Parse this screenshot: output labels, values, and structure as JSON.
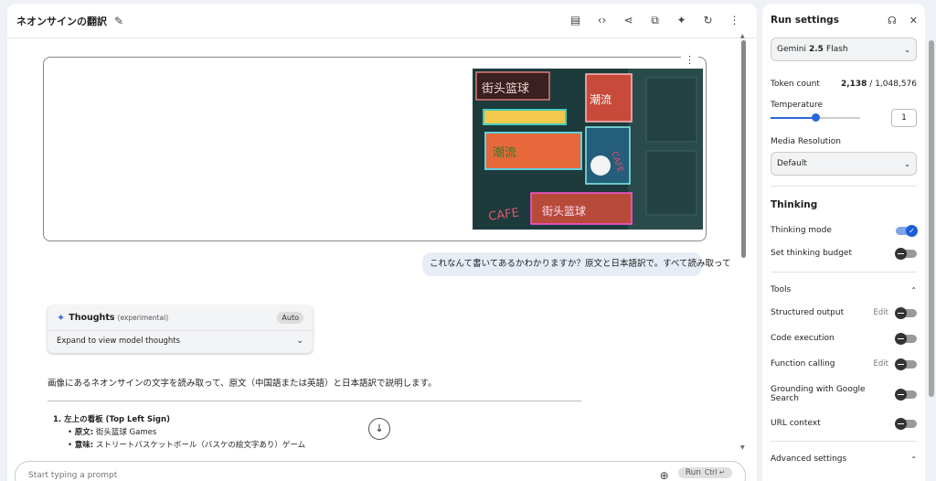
{
  "header": {
    "title": "ネオンサインの翻訳",
    "actions": [
      "clipboard-icon",
      "code-icon",
      "share-icon",
      "copy-icon",
      "sparkle-icon",
      "refresh-icon",
      "more-vert-icon"
    ]
  },
  "chat": {
    "image_alt": "neon-signs-photo",
    "image_signs": {
      "top_left": "街头篮球",
      "top_right": "潮流",
      "center": "潮流",
      "bottom_left": "CAFE",
      "bottom_right": "街头篮球",
      "right_vertical": "CAFE"
    },
    "user_message": "これなんて書いてあるかわかりますか？原文と日本語訳で。すべて読み取って",
    "thoughts": {
      "title": "Thoughts",
      "subtitle": "(experimental)",
      "badge": "Auto",
      "expand_label": "Expand to view model thoughts"
    },
    "answer_intro": "画像にあるネオンサインの文字を読み取って、原文（中国語または英語）と日本語訳で説明します。",
    "list_item_1": {
      "heading": "1. 左上の看板 (Top Left Sign)",
      "original_label": "原文:",
      "original_value": " 街头篮球 Games",
      "meaning_label": "意味:",
      "meaning_value": " ストリートバスケットボール（バスケの絵文字あり）ゲーム"
    }
  },
  "prompt": {
    "placeholder": "Start typing a prompt",
    "run_label": "Run",
    "run_shortcut": "Ctrl ↵"
  },
  "settings": {
    "title": "Run settings",
    "model_prefix": "Gemini",
    "model_version": "2.5",
    "model_suffix": "Flash",
    "token_count_label": "Token count",
    "token_used": "2,138",
    "token_total": " / 1,048,576",
    "temperature_label": "Temperature",
    "temperature_value": "1",
    "temperature_fraction": 0.5,
    "media_resolution_label": "Media Resolution",
    "media_resolution_value": "Default",
    "thinking_section": "Thinking",
    "thinking_mode_label": "Thinking mode",
    "thinking_mode_on": true,
    "thinking_budget_label": "Set thinking budget",
    "tools_section": "Tools",
    "structured_output_label": "Structured output",
    "edit_label": "Edit",
    "code_execution_label": "Code execution",
    "function_calling_label": "Function calling",
    "grounding_label": "Grounding with Google Search",
    "url_context_label": "URL context",
    "advanced_label": "Advanced settings"
  },
  "colors": {
    "accent": "#1a5fd8",
    "user_bubble": "#e7edf6",
    "neon_bg": "#1e3d3f"
  }
}
